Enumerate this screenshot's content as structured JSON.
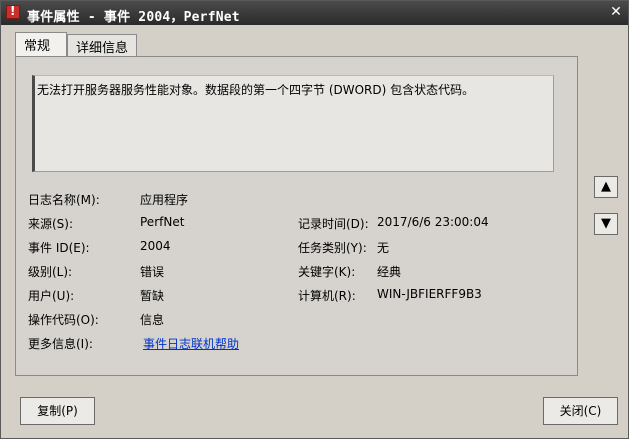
{
  "window": {
    "title": "事件属性 - 事件 2004，PerfNet",
    "close_glyph": "✕"
  },
  "tabs": [
    {
      "label": "常规",
      "active": true
    },
    {
      "label": "详细信息",
      "active": false
    }
  ],
  "description": "无法打开服务器服务性能对象。数据段的第一个四字节 (DWORD) 包含状态代码。",
  "fields": {
    "log_name": {
      "label": "日志名称(M):",
      "value": "应用程序"
    },
    "source": {
      "label": "来源(S):",
      "value": "PerfNet"
    },
    "event_id": {
      "label": "事件 ID(E):",
      "value": "2004"
    },
    "level": {
      "label": "级别(L):",
      "value": "错误"
    },
    "user": {
      "label": "用户(U):",
      "value": "暂缺"
    },
    "opcode": {
      "label": "操作代码(O):",
      "value": "信息"
    },
    "more_info": {
      "label": "更多信息(I):",
      "value": "事件日志联机帮助"
    },
    "logged": {
      "label": "记录时间(D):",
      "value": "2017/6/6 23:00:04"
    },
    "task_category": {
      "label": "任务类别(Y):",
      "value": "无"
    },
    "keywords": {
      "label": "关键字(K):",
      "value": "经典"
    },
    "computer": {
      "label": "计算机(R):",
      "value": "WIN-JBFIERFF9B3"
    }
  },
  "nav": {
    "up_glyph": "▲",
    "down_glyph": "▼"
  },
  "buttons": {
    "copy": "复制(P)",
    "close": "关闭(C)"
  },
  "colors": {
    "link": "#0033cc",
    "titlebar": "#2a2a2a"
  }
}
